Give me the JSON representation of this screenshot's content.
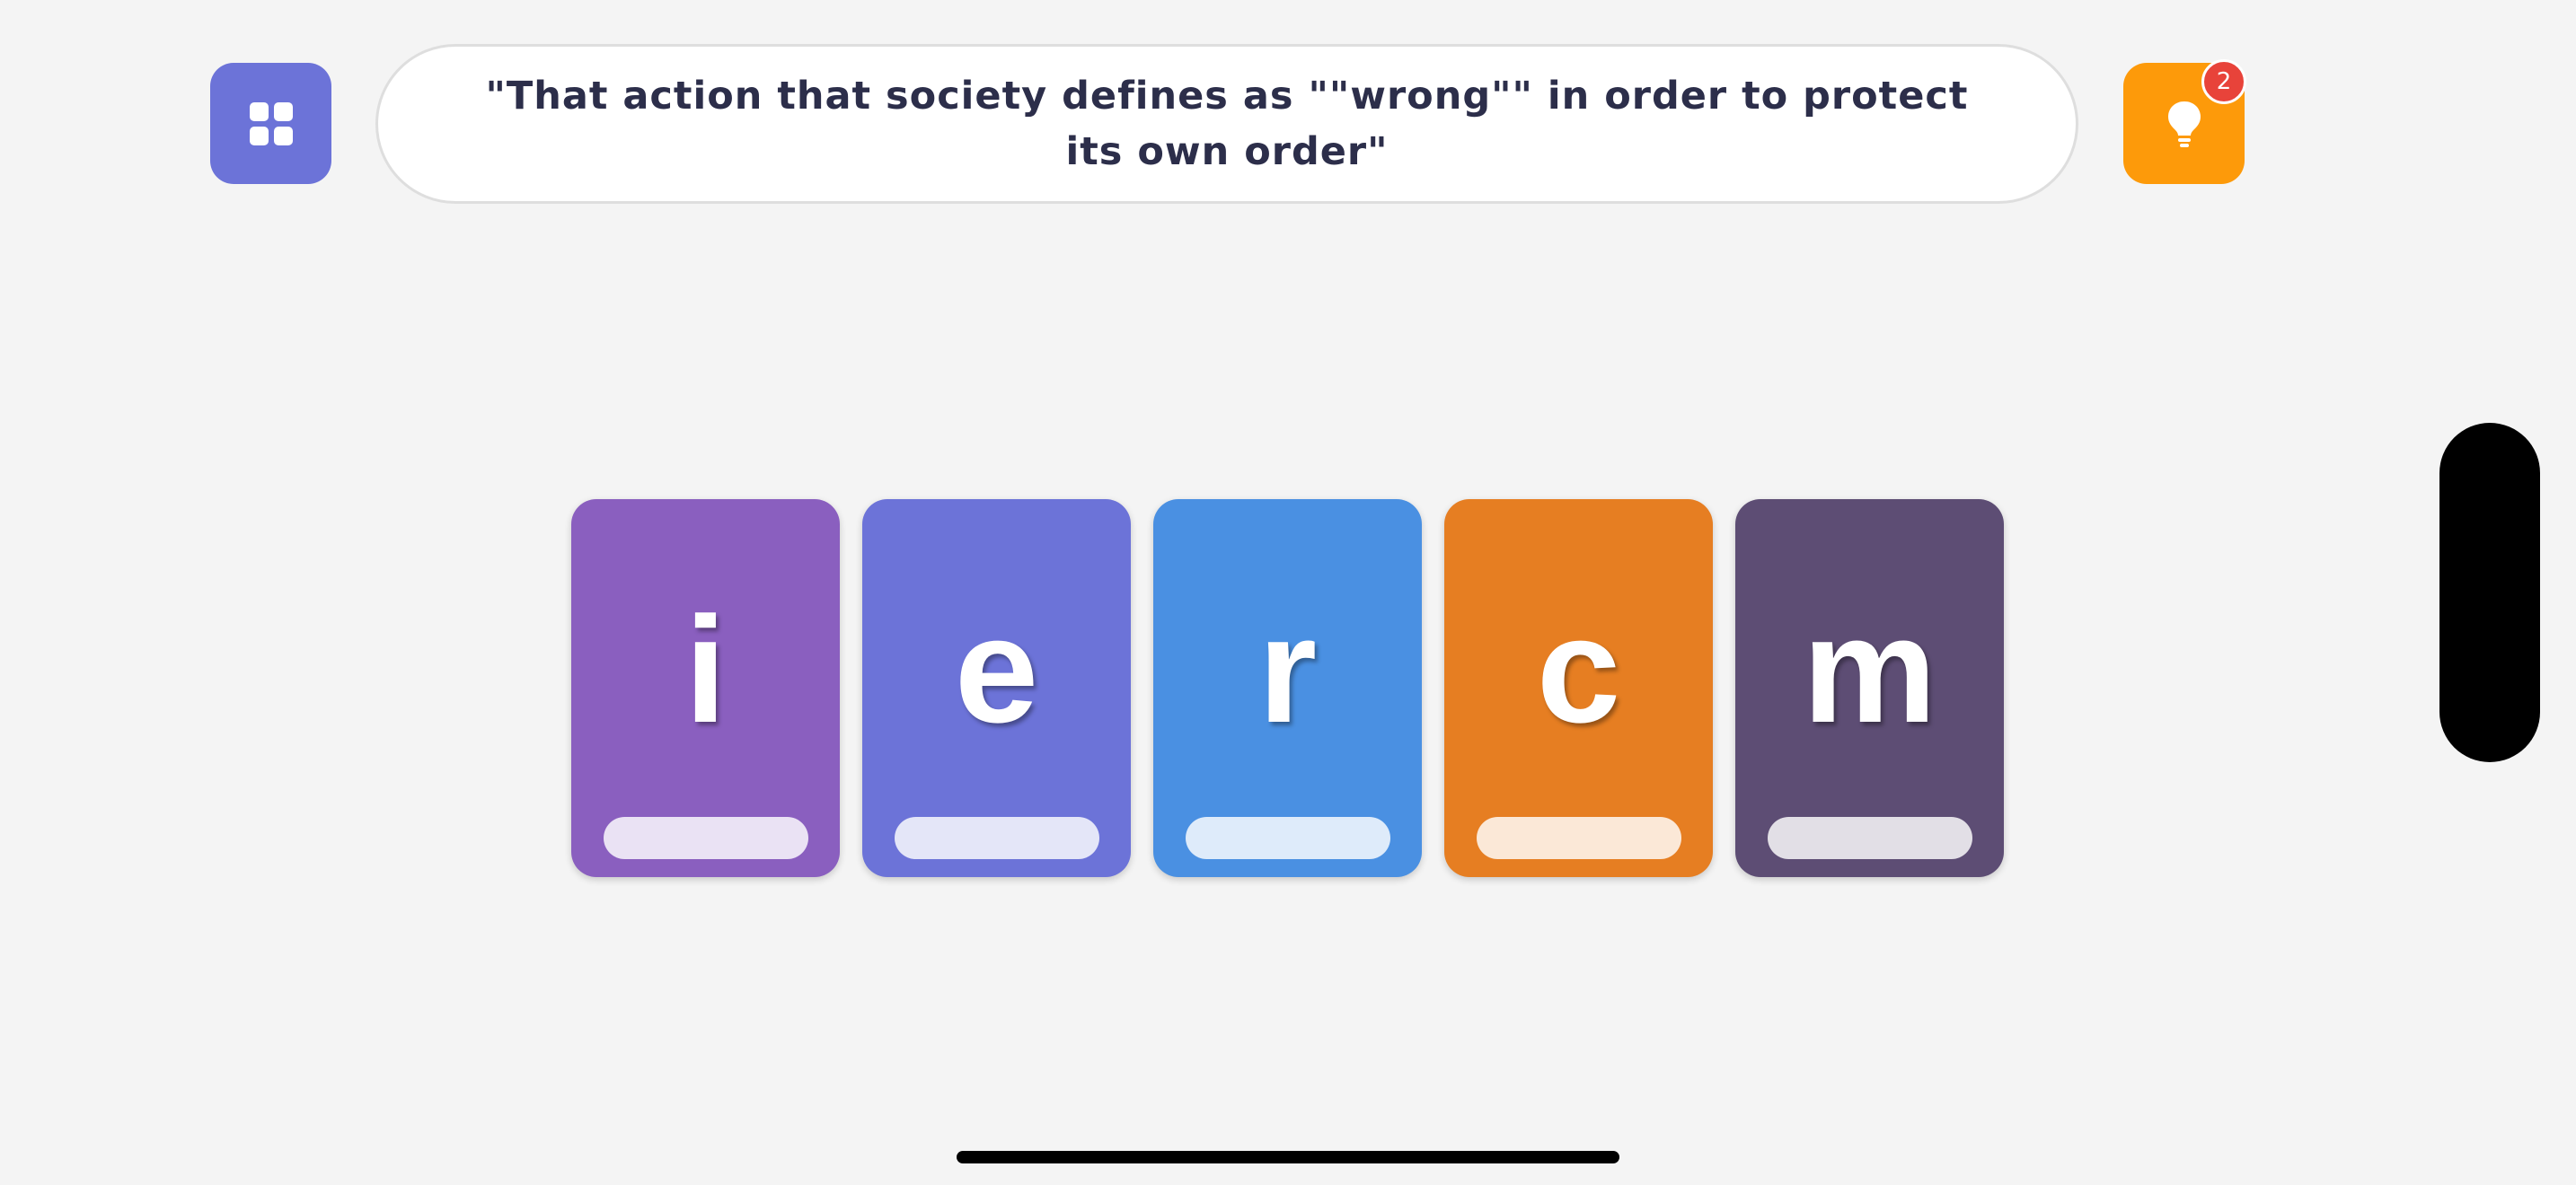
{
  "header": {
    "menu_icon": "grid-icon",
    "clue": "\"That action that society defines as \"\"wrong\"\" in order to protect its own order\"",
    "hint_icon": "lightbulb-icon",
    "hint_count": "2"
  },
  "tiles": [
    {
      "letter": "i",
      "color": "#8a5fbf"
    },
    {
      "letter": "e",
      "color": "#6c73d8"
    },
    {
      "letter": "r",
      "color": "#4a90e2"
    },
    {
      "letter": "c",
      "color": "#e67e22"
    },
    {
      "letter": "m",
      "color": "#5d4d74"
    }
  ],
  "colors": {
    "menu_button": "#6c73d8",
    "hint_button": "#fd9a0a",
    "hint_badge": "#e8433a",
    "background": "#f4f4f4",
    "clue_text": "#2c2e4a"
  }
}
